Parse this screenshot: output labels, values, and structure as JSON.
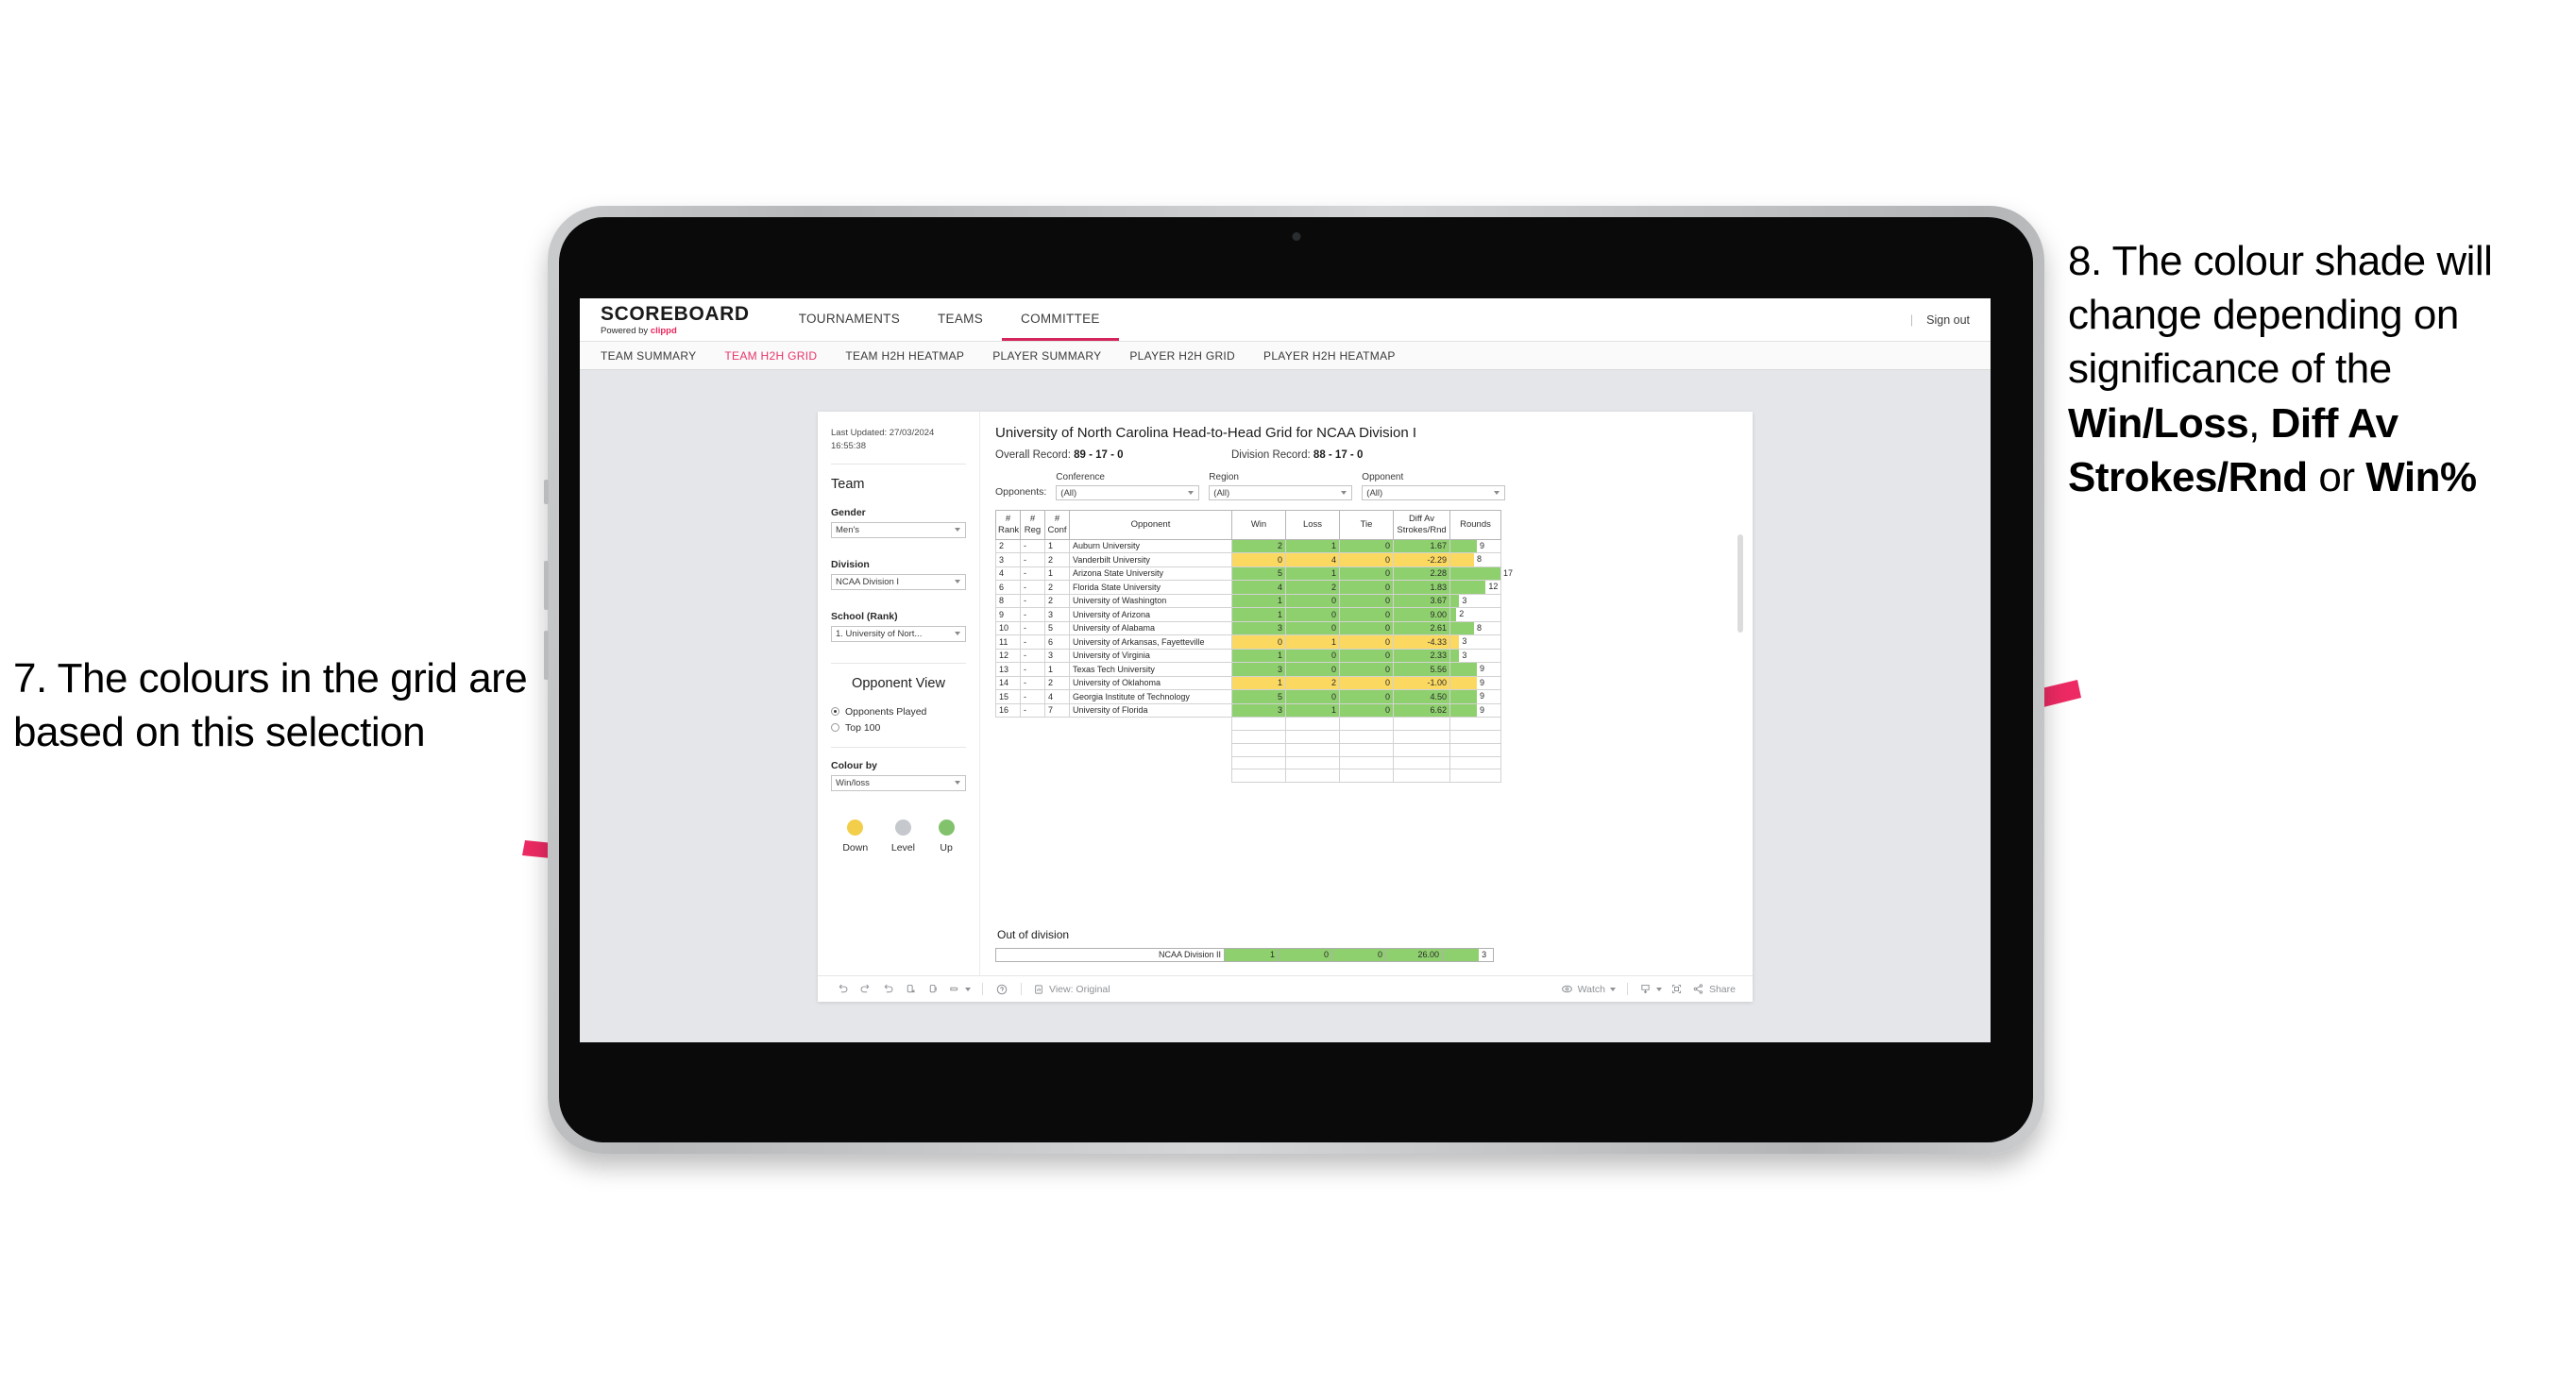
{
  "annotations": {
    "left": {
      "id": "annot-7",
      "text": "7. The colours in the grid are based on this selection"
    },
    "right": {
      "id": "annot-8",
      "prefix": "8. The colour shade will change depending on significance of the ",
      "bold1": "Win/Loss",
      "mid1": ", ",
      "bold2": "Diff Av Strokes/Rnd",
      "mid2": " or ",
      "bold3": "Win%"
    },
    "arrow_color": "#ED2A63"
  },
  "app": {
    "brand_name": "SCOREBOARD",
    "brand_sub_prefix": "Powered by ",
    "brand_sub_accent": "clippd",
    "accent_color": "#E8245C",
    "sign_out": "Sign out",
    "nav_tabs": [
      {
        "label": "TOURNAMENTS",
        "active": false
      },
      {
        "label": "TEAMS",
        "active": false
      },
      {
        "label": "COMMITTEE",
        "active": true
      }
    ],
    "sub_tabs": [
      {
        "label": "TEAM SUMMARY",
        "active": false
      },
      {
        "label": "TEAM H2H GRID",
        "active": true
      },
      {
        "label": "TEAM H2H HEATMAP",
        "active": false
      },
      {
        "label": "PLAYER SUMMARY",
        "active": false
      },
      {
        "label": "PLAYER H2H GRID",
        "active": false
      },
      {
        "label": "PLAYER H2H HEATMAP",
        "active": false
      }
    ]
  },
  "sidebar": {
    "last_updated": "Last Updated: 27/03/2024 16:55:38",
    "team_heading": "Team",
    "gender": {
      "label": "Gender",
      "value": "Men's"
    },
    "division": {
      "label": "Division",
      "value": "NCAA Division I"
    },
    "school": {
      "label": "School (Rank)",
      "value": "1. University of Nort..."
    },
    "opponent_view": {
      "heading": "Opponent View",
      "options": [
        {
          "label": "Opponents Played",
          "selected": true
        },
        {
          "label": "Top 100",
          "selected": false
        }
      ]
    },
    "colour_by": {
      "label": "Colour by",
      "value": "Win/loss"
    },
    "legend": [
      {
        "caption": "Down",
        "color": "#F2CE4B"
      },
      {
        "caption": "Level",
        "color": "#C5C8CC"
      },
      {
        "caption": "Up",
        "color": "#82C26C"
      }
    ]
  },
  "main": {
    "title": "University of North Carolina Head-to-Head Grid for NCAA Division I",
    "overall_record_label": "Overall Record: ",
    "overall_record_value": "89 - 17 - 0",
    "division_record_label": "Division Record: ",
    "division_record_value": "88 - 17 - 0",
    "opponents_label": "Opponents:",
    "filters": [
      {
        "label": "Conference",
        "value": "(All)"
      },
      {
        "label": "Region",
        "value": "(All)"
      },
      {
        "label": "Opponent",
        "value": "(All)"
      }
    ],
    "table": {
      "headers": [
        "#\nRank",
        "#\nReg",
        "#\nConf",
        "Opponent",
        "Win",
        "Loss",
        "Tie",
        "Diff Av\nStrokes/Rnd",
        "Rounds"
      ],
      "header_rank_l1": "#",
      "header_rank_l2": "Rank",
      "header_reg_l1": "#",
      "header_reg_l2": "Reg",
      "header_conf_l1": "#",
      "header_conf_l2": "Conf",
      "header_opponent": "Opponent",
      "header_win": "Win",
      "header_loss": "Loss",
      "header_tie": "Tie",
      "header_diff_l1": "Diff Av",
      "header_diff_l2": "Strokes/Rnd",
      "header_rounds": "Rounds",
      "rows": [
        {
          "rank": "2",
          "reg": "-",
          "conf": "1",
          "opponent": "Auburn University",
          "win": "2",
          "loss": "1",
          "tie": "0",
          "diff": "1.67",
          "rounds": "9",
          "state": "up"
        },
        {
          "rank": "3",
          "reg": "-",
          "conf": "2",
          "opponent": "Vanderbilt University",
          "win": "0",
          "loss": "4",
          "tie": "0",
          "diff": "-2.29",
          "rounds": "8",
          "state": "down"
        },
        {
          "rank": "4",
          "reg": "-",
          "conf": "1",
          "opponent": "Arizona State University",
          "win": "5",
          "loss": "1",
          "tie": "0",
          "diff": "2.28",
          "rounds": "17",
          "state": "up"
        },
        {
          "rank": "6",
          "reg": "-",
          "conf": "2",
          "opponent": "Florida State University",
          "win": "4",
          "loss": "2",
          "tie": "0",
          "diff": "1.83",
          "rounds": "12",
          "state": "up"
        },
        {
          "rank": "8",
          "reg": "-",
          "conf": "2",
          "opponent": "University of Washington",
          "win": "1",
          "loss": "0",
          "tie": "0",
          "diff": "3.67",
          "rounds": "3",
          "state": "up"
        },
        {
          "rank": "9",
          "reg": "-",
          "conf": "3",
          "opponent": "University of Arizona",
          "win": "1",
          "loss": "0",
          "tie": "0",
          "diff": "9.00",
          "rounds": "2",
          "state": "up"
        },
        {
          "rank": "10",
          "reg": "-",
          "conf": "5",
          "opponent": "University of Alabama",
          "win": "3",
          "loss": "0",
          "tie": "0",
          "diff": "2.61",
          "rounds": "8",
          "state": "up"
        },
        {
          "rank": "11",
          "reg": "-",
          "conf": "6",
          "opponent": "University of Arkansas, Fayetteville",
          "win": "0",
          "loss": "1",
          "tie": "0",
          "diff": "-4.33",
          "rounds": "3",
          "state": "down"
        },
        {
          "rank": "12",
          "reg": "-",
          "conf": "3",
          "opponent": "University of Virginia",
          "win": "1",
          "loss": "0",
          "tie": "0",
          "diff": "2.33",
          "rounds": "3",
          "state": "up"
        },
        {
          "rank": "13",
          "reg": "-",
          "conf": "1",
          "opponent": "Texas Tech University",
          "win": "3",
          "loss": "0",
          "tie": "0",
          "diff": "5.56",
          "rounds": "9",
          "state": "up"
        },
        {
          "rank": "14",
          "reg": "-",
          "conf": "2",
          "opponent": "University of Oklahoma",
          "win": "1",
          "loss": "2",
          "tie": "0",
          "diff": "-1.00",
          "rounds": "9",
          "state": "down"
        },
        {
          "rank": "15",
          "reg": "-",
          "conf": "4",
          "opponent": "Georgia Institute of Technology",
          "win": "5",
          "loss": "0",
          "tie": "0",
          "diff": "4.50",
          "rounds": "9",
          "state": "up"
        },
        {
          "rank": "16",
          "reg": "-",
          "conf": "7",
          "opponent": "University of Florida",
          "win": "3",
          "loss": "1",
          "tie": "0",
          "diff": "6.62",
          "rounds": "9",
          "state": "up"
        }
      ],
      "max_rounds": 17
    },
    "out_of_division": {
      "heading": "Out of division",
      "row": {
        "label": "NCAA Division II",
        "win": "1",
        "loss": "0",
        "tie": "0",
        "diff": "26.00",
        "rounds": "3",
        "state": "up"
      }
    },
    "colors": {
      "up": "#8FD06E",
      "down": "#FBD961",
      "level": "#C5C8CC"
    }
  },
  "toolbar": {
    "view_label": "View: Original",
    "watch_label": "Watch",
    "share_label": "Share"
  }
}
